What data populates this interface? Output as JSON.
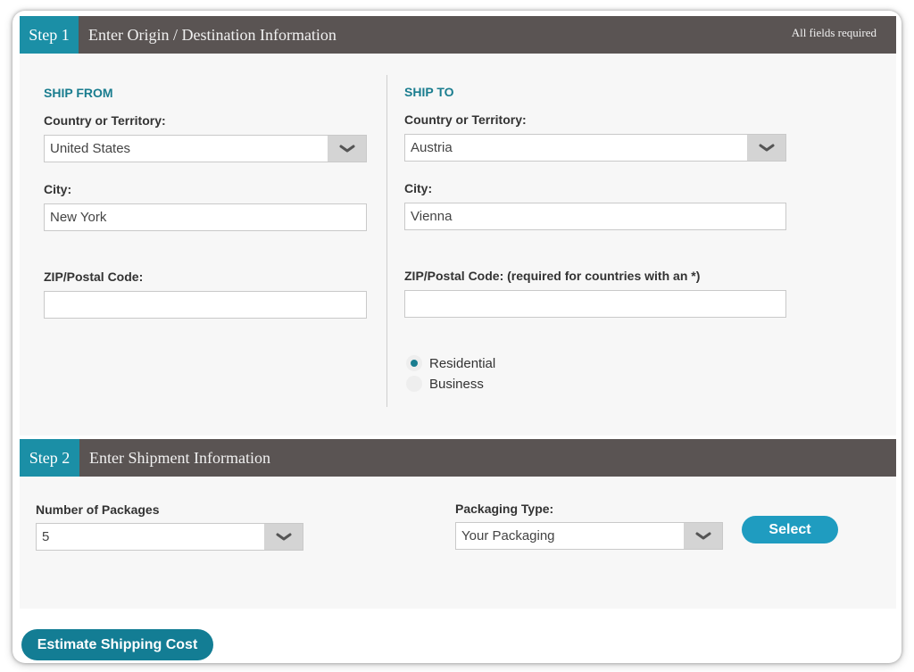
{
  "step1": {
    "tab_label": "Step 1",
    "title": "Enter Origin / Destination Information",
    "note": "All fields required"
  },
  "ship_from": {
    "heading": "SHIP FROM",
    "country_label": "Country or Territory:",
    "country_value": "United States",
    "city_label": "City:",
    "city_value": "New York",
    "zip_label": "ZIP/Postal Code:",
    "zip_value": ""
  },
  "ship_to": {
    "heading": "SHIP TO",
    "country_label": "Country or Territory:",
    "country_value": "Austria",
    "city_label": "City:",
    "city_value": "Vienna",
    "zip_label": "ZIP/Postal Code: (required for countries with an *)",
    "zip_value": "",
    "address_type": {
      "options": [
        "Residential",
        "Business"
      ],
      "selected": "Residential"
    }
  },
  "step2": {
    "tab_label": "Step 2",
    "title": "Enter Shipment Information"
  },
  "shipment": {
    "packages_label": "Number of Packages",
    "packages_value": "5",
    "packaging_label": "Packaging Type:",
    "packaging_value": "Your Packaging",
    "select_button": "Select"
  },
  "actions": {
    "estimate_button": "Estimate Shipping Cost"
  },
  "colors": {
    "accent_teal": "#1b8fa6",
    "header_dark": "#5a5453",
    "button_blue": "#1f9cc0",
    "button_teal": "#137d94"
  }
}
